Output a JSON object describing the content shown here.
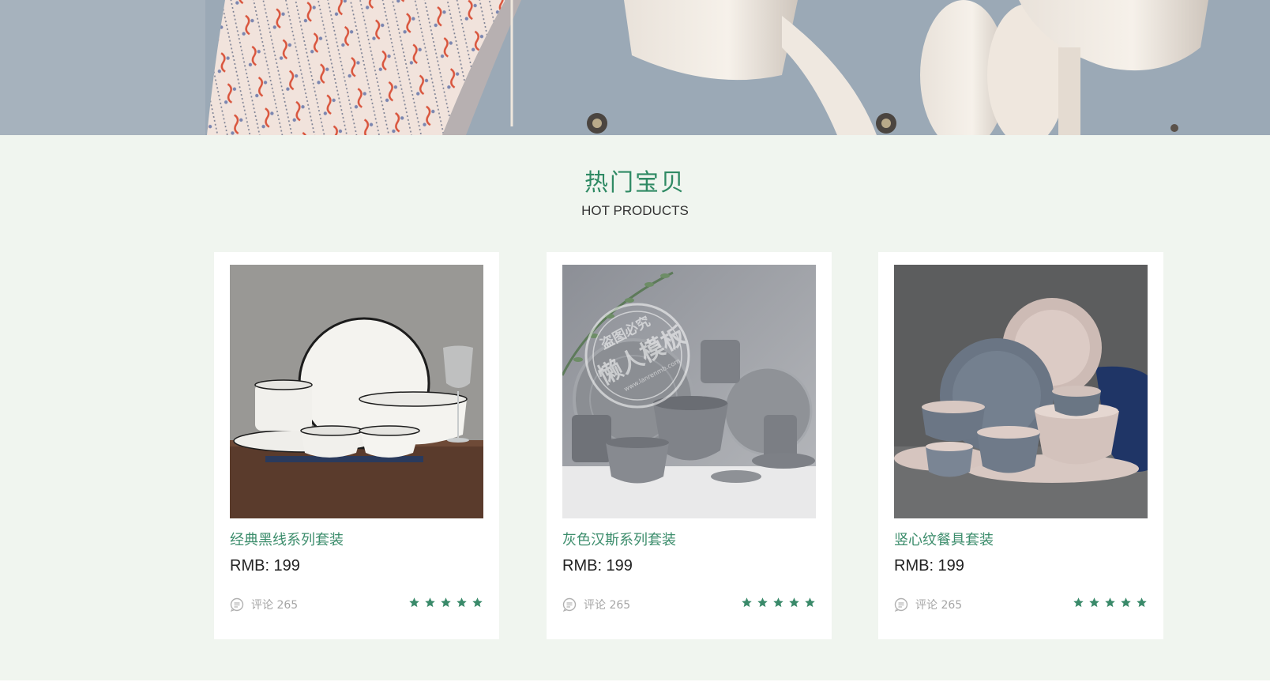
{
  "hero": {
    "image": "tableware-wall-banner"
  },
  "section": {
    "title": "热门宝贝",
    "subtitle": "HOT PRODUCTS"
  },
  "products": [
    {
      "name": "经典黑线系列套装",
      "price": "RMB: 199",
      "comments": "评论 265",
      "rating": 5,
      "image": "white-plates-black-rim-set"
    },
    {
      "name": "灰色汉斯系列套装",
      "price": "RMB: 199",
      "comments": "评论 265",
      "rating": 5,
      "image": "grey-tableware-set",
      "watermark": {
        "line1": "盗图必究",
        "line2": "懒人模板",
        "url": "www.lanrenmb.com"
      }
    },
    {
      "name": "竖心纹餐具套装",
      "price": "RMB: 199",
      "comments": "评论 265",
      "rating": 5,
      "image": "blue-pink-ribbed-tableware-set"
    }
  ],
  "icons": {
    "comment": "speech-bubble-icon",
    "star": "star-icon"
  },
  "colors": {
    "accent": "#2f8a64",
    "product_name": "#3c8d6c",
    "star": "#3a8a6a",
    "section_bg": "#f0f5ef"
  }
}
